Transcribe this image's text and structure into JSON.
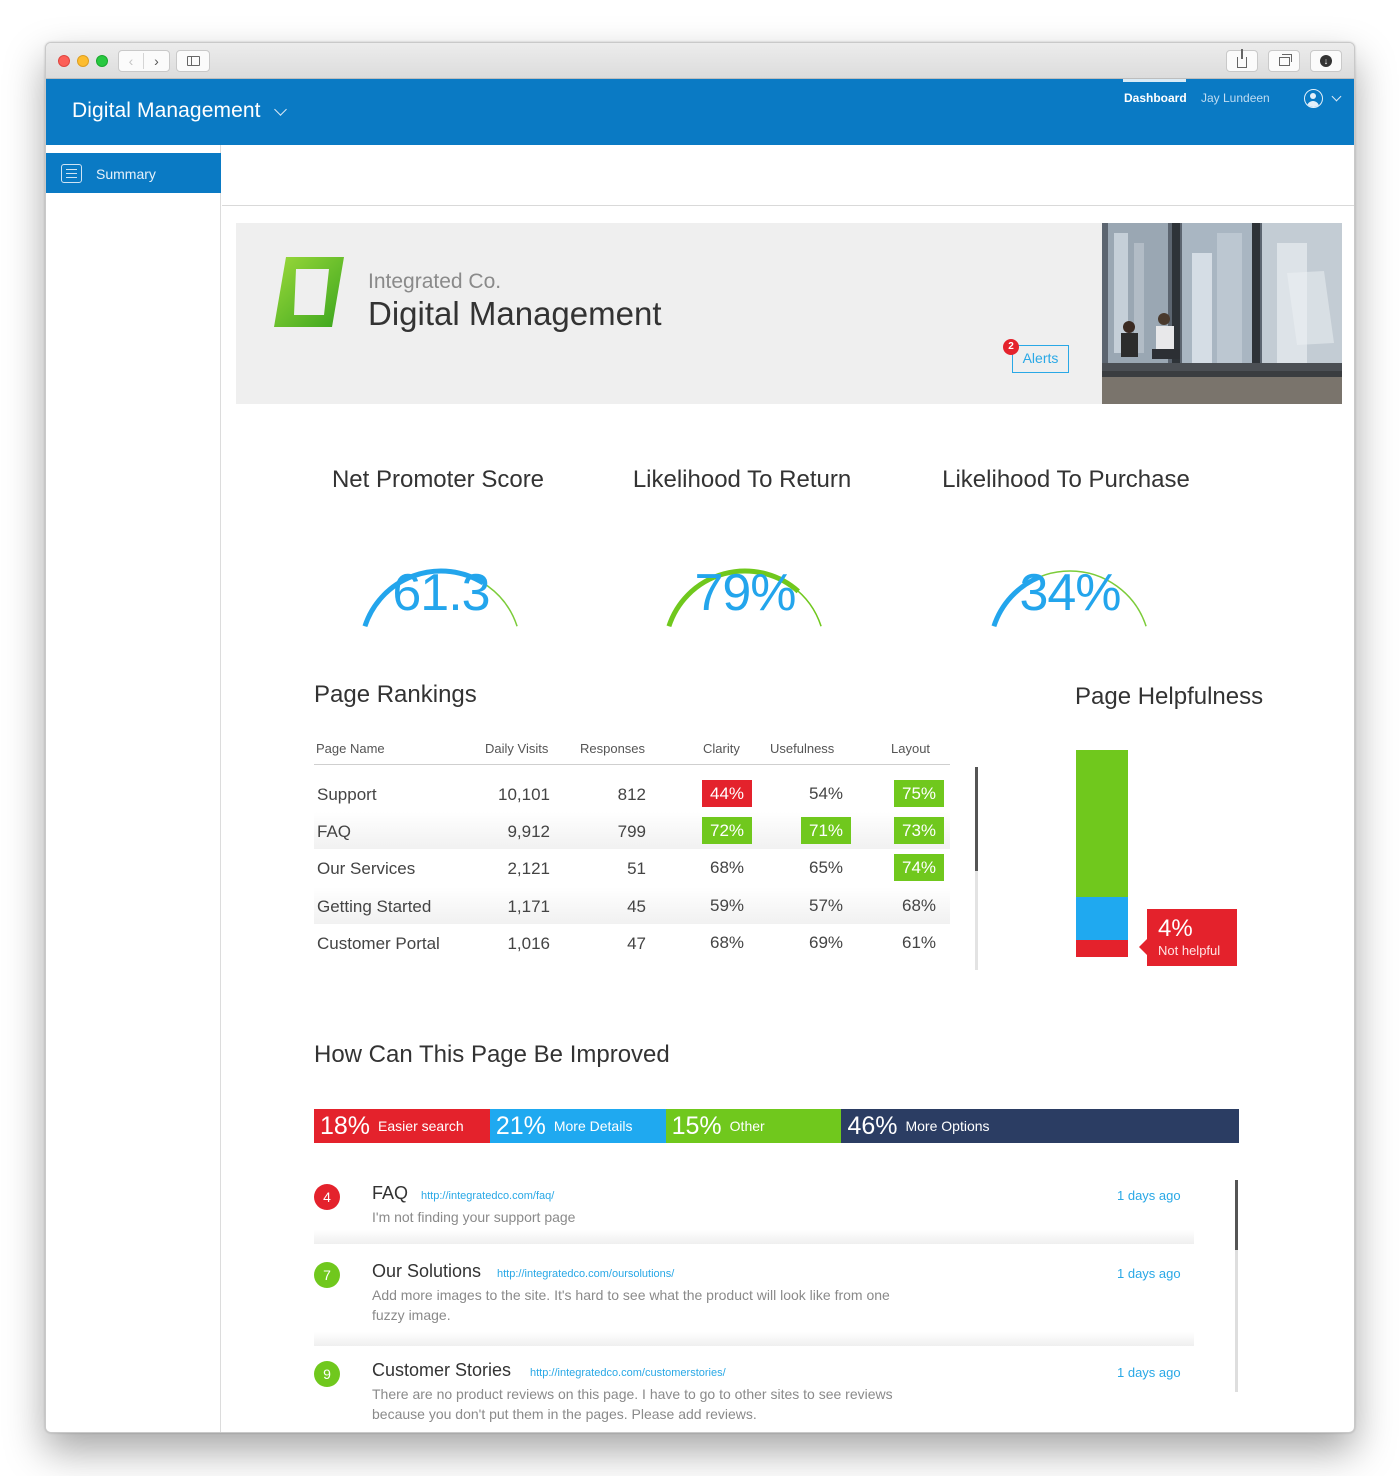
{
  "app": {
    "title": "Digital Management",
    "nav_dashboard": "Dashboard",
    "nav_user": "Jay Lundeen"
  },
  "sidebar": {
    "items": [
      {
        "label": "Summary",
        "icon": "list-icon"
      }
    ]
  },
  "hero": {
    "company": "Integrated Co.",
    "product": "Digital Management",
    "alerts_label": "Alerts",
    "alerts_count": "2"
  },
  "gauges": [
    {
      "title": "Net Promoter Score",
      "value": "61.3",
      "fill": 0.72,
      "color": "#23a5ec"
    },
    {
      "title": "Likelihood To Return",
      "value": "79%",
      "fill": 0.79,
      "color": "#70c81d"
    },
    {
      "title": "Likelihood To Purchase",
      "value": "34%",
      "fill": 0.34,
      "color": "#23a5ec"
    }
  ],
  "rankings": {
    "title": "Page Rankings",
    "columns": [
      "Page Name",
      "Daily Visits",
      "Responses",
      "Clarity",
      "Usefulness",
      "Layout"
    ],
    "rows": [
      {
        "page": "Support",
        "visits": "10,101",
        "responses": "812",
        "clarity": "44%",
        "clarity_status": "red",
        "usefulness": "54%",
        "usefulness_status": "none",
        "layout": "75%",
        "layout_status": "green"
      },
      {
        "page": "FAQ",
        "visits": "9,912",
        "responses": "799",
        "clarity": "72%",
        "clarity_status": "green",
        "usefulness": "71%",
        "usefulness_status": "green",
        "layout": "73%",
        "layout_status": "green"
      },
      {
        "page": "Our Services",
        "visits": "2,121",
        "responses": "51",
        "clarity": "68%",
        "clarity_status": "none",
        "usefulness": "65%",
        "usefulness_status": "none",
        "layout": "74%",
        "layout_status": "green"
      },
      {
        "page": "Getting Started",
        "visits": "1,171",
        "responses": "45",
        "clarity": "59%",
        "clarity_status": "none",
        "usefulness": "57%",
        "usefulness_status": "none",
        "layout": "68%",
        "layout_status": "none"
      },
      {
        "page": "Customer Portal",
        "visits": "1,016",
        "responses": "47",
        "clarity": "68%",
        "clarity_status": "none",
        "usefulness": "69%",
        "usefulness_status": "none",
        "layout": "61%",
        "layout_status": "none"
      }
    ]
  },
  "helpfulness": {
    "title": "Page Helpfulness",
    "segments": [
      {
        "share": 0.71,
        "color": "#70c81d"
      },
      {
        "share": 0.21,
        "color": "#1fa9f0"
      },
      {
        "share": 0.08,
        "color": "#e4222c"
      }
    ],
    "callout_value": "4%",
    "callout_label": "Not helpful"
  },
  "improve": {
    "title": "How Can This Page Be Improved",
    "segments": [
      {
        "pct": "18%",
        "label": "Easier search",
        "share": 0.19,
        "color": "#e4222c"
      },
      {
        "pct": "21%",
        "label": "More Details",
        "share": 0.19,
        "color": "#1fa9f0"
      },
      {
        "pct": "15%",
        "label": "Other",
        "share": 0.19,
        "color": "#70c81d"
      },
      {
        "pct": "46%",
        "label": "More Options",
        "share": 0.43,
        "color": "#2b3d63"
      }
    ]
  },
  "feedback": [
    {
      "score": "4",
      "color": "red",
      "name": "FAQ",
      "url": "http://integratedco.com/faq/",
      "text": "I'm not finding your support page",
      "when": "1 days ago"
    },
    {
      "score": "7",
      "color": "green",
      "name": "Our Solutions",
      "url": "http://integratedco.com/oursolutions/",
      "text": "Add more images to the site. It's hard to see what the product will look like from one fuzzy image.",
      "when": "1 days ago"
    },
    {
      "score": "9",
      "color": "green",
      "name": "Customer Stories",
      "url": "http://integratedco.com/customerstories/",
      "text": "There are no product reviews on this page. I have to go to other sites to see reviews because you don't put them in the pages. Please add reviews.",
      "when": "1 days ago"
    }
  ]
}
